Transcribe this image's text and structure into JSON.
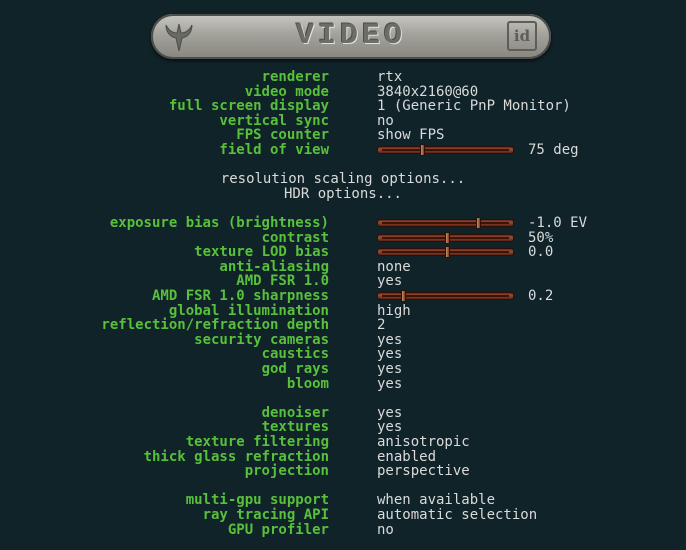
{
  "header": {
    "title": "VIDEO",
    "logo_left": "quake-logo-icon",
    "logo_right": "id"
  },
  "rows": {
    "renderer": {
      "label": "renderer",
      "value": "rtx"
    },
    "video_mode": {
      "label": "video mode",
      "value": "3840x2160@60"
    },
    "full_screen": {
      "label": "full screen display",
      "value": "1 (Generic PnP Monitor)"
    },
    "vertical_sync": {
      "label": "vertical sync",
      "value": "no"
    },
    "fps_counter": {
      "label": "FPS counter",
      "value": "show FPS"
    },
    "fov": {
      "label": "field of view",
      "value": "75 deg",
      "level": 0.3
    },
    "resolution_scaling": {
      "label": "resolution scaling options..."
    },
    "hdr_options": {
      "label": "HDR options..."
    },
    "exposure_bias": {
      "label": "exposure bias (brightness)",
      "value": "-1.0 EV",
      "level": 0.75
    },
    "contrast": {
      "label": "contrast",
      "value": "50%",
      "level": 0.5
    },
    "texture_lod_bias": {
      "label": "texture LOD bias",
      "value": "0.0",
      "level": 0.5
    },
    "anti_aliasing": {
      "label": "anti-aliasing",
      "value": "none"
    },
    "amd_fsr": {
      "label": "AMD FSR 1.0",
      "value": "yes"
    },
    "fsr_sharpness": {
      "label": "AMD FSR 1.0 sharpness",
      "value": "0.2",
      "level": 0.15
    },
    "global_illumination": {
      "label": "global illumination",
      "value": "high"
    },
    "reflection_depth": {
      "label": "reflection/refraction depth",
      "value": "2"
    },
    "security_cameras": {
      "label": "security cameras",
      "value": "yes"
    },
    "caustics": {
      "label": "caustics",
      "value": "yes"
    },
    "god_rays": {
      "label": "god rays",
      "value": "yes"
    },
    "bloom": {
      "label": "bloom",
      "value": "yes"
    },
    "denoiser": {
      "label": "denoiser",
      "value": "yes"
    },
    "textures": {
      "label": "textures",
      "value": "yes"
    },
    "texture_filtering": {
      "label": "texture filtering",
      "value": "anisotropic"
    },
    "thick_glass": {
      "label": "thick glass refraction",
      "value": "enabled"
    },
    "projection": {
      "label": "projection",
      "value": "perspective"
    },
    "multi_gpu": {
      "label": "multi-gpu support",
      "value": "when available"
    },
    "ray_tracing_api": {
      "label": "ray tracing API",
      "value": "automatic selection"
    },
    "gpu_profiler": {
      "label": "GPU profiler",
      "value": "no"
    }
  },
  "colors": {
    "label": "#58c03a",
    "value": "#dadada",
    "background": "#0f2329",
    "slider": "#9a4e30"
  }
}
